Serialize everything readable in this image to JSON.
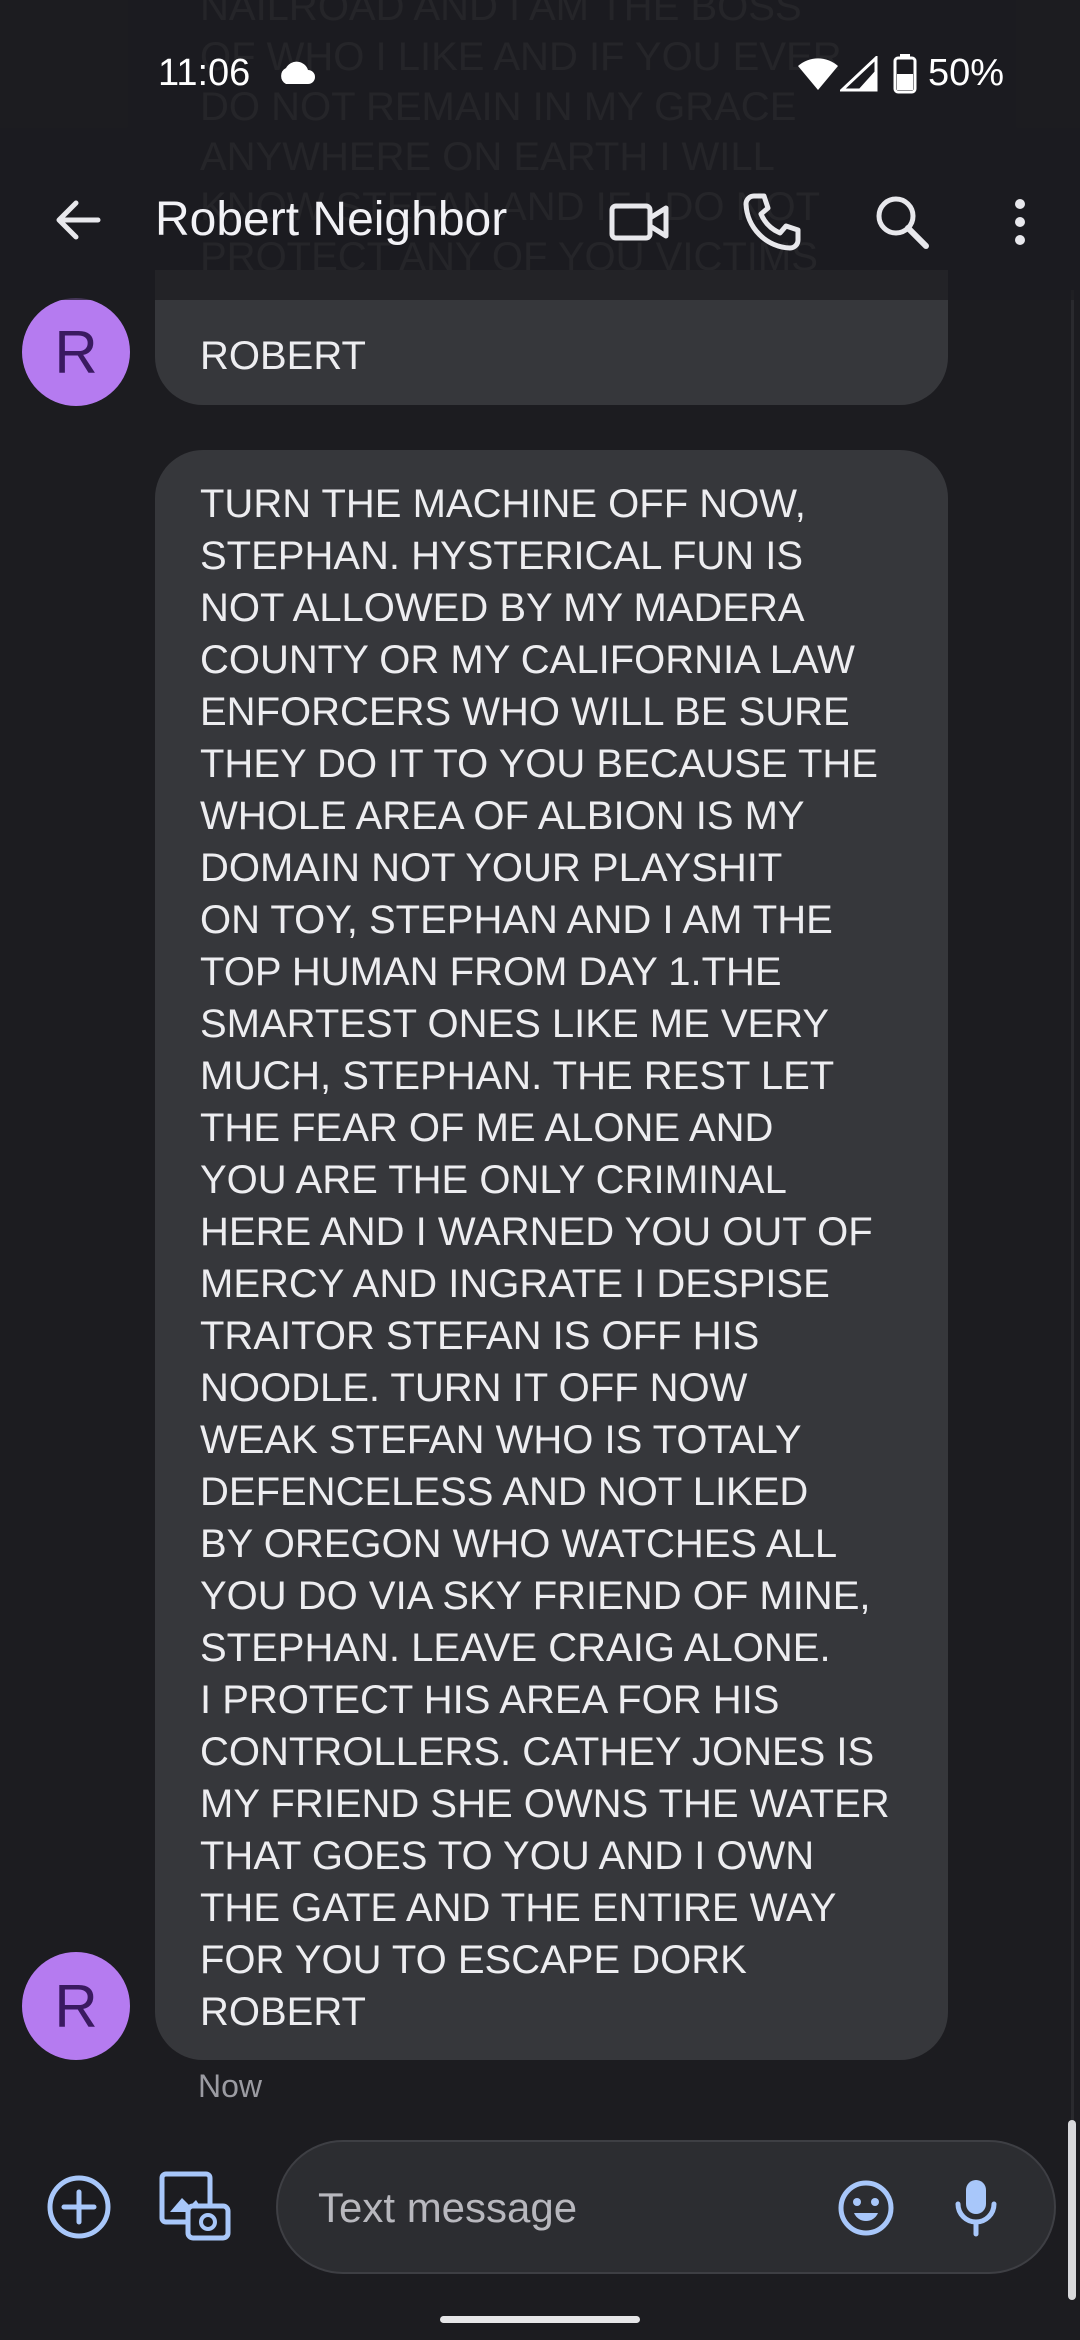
{
  "status_bar": {
    "time": "11:06",
    "battery_percent": "50%"
  },
  "ghost_text": "NAILROAD AND I AM THE BOSS\nOF WHO I LIKE AND IF YOU EVER\nDO NOT REMAIN IN MY GRACE\nANYWHERE ON EARTH I WILL\nKNOW STEFAN AND IF I DO NOT\nPROTECT ANY OF YOU VICTIMS",
  "header": {
    "contact_name": "Robert Neighbor"
  },
  "messages": [
    {
      "avatar_letter": "R",
      "text": "ROBERT"
    },
    {
      "avatar_letter": "R",
      "lines": [
        "TURN THE MACHINE OFF NOW,",
        "STEPHAN. HYSTERICAL FUN IS",
        "NOT ALLOWED BY MY MADERA",
        "COUNTY OR MY CALIFORNIA LAW",
        "ENFORCERS WHO WILL BE SURE",
        "THEY DO IT TO YOU BECAUSE THE",
        "WHOLE AREA OF ALBION IS MY",
        "DOMAIN NOT YOUR PLAYSHIT",
        "ON TOY, STEPHAN AND I AM THE",
        "TOP HUMAN FROM DAY 1.THE",
        "SMARTEST ONES LIKE ME VERY",
        "MUCH, STEPHAN. THE REST LET",
        "THE FEAR OF ME ALONE AND",
        "YOU ARE THE ONLY CRIMINAL",
        "HERE AND I WARNED YOU OUT OF",
        "MERCY AND INGRATE I DESPISE",
        "TRAITOR STEFAN IS OFF HIS",
        "NOODLE. TURN IT OFF NOW",
        "WEAK STEFAN WHO IS TOTALY",
        "DEFENCELESS AND NOT LIKED",
        "BY OREGON WHO WATCHES ALL",
        "YOU DO VIA SKY FRIEND OF MINE,",
        "STEPHAN. LEAVE CRAIG ALONE.",
        "I PROTECT HIS AREA FOR HIS",
        "CONTROLLERS. CATHEY JONES IS",
        "MY FRIEND SHE OWNS THE WATER",
        "THAT GOES TO YOU AND I OWN",
        "THE GATE AND THE ENTIRE WAY",
        "FOR YOU TO ESCAPE DORK",
        "ROBERT"
      ],
      "timestamp": "Now"
    }
  ],
  "compose": {
    "placeholder": "Text message"
  },
  "icons": {
    "back": "arrow-left-icon",
    "video": "video-call-icon",
    "call": "phone-icon",
    "search": "search-icon",
    "more": "more-vert-icon",
    "add": "add-circle-icon",
    "gallery": "gallery-icon",
    "emoji": "emoji-icon",
    "mic": "mic-icon",
    "cloud": "cloud-icon",
    "wifi": "wifi-icon",
    "signal": "signal-icon",
    "battery": "battery-icon"
  },
  "colors": {
    "avatar": "#b57bf0",
    "bubble": "#36373b",
    "accent": "#a8c7fa",
    "background": "#1c1c20"
  }
}
